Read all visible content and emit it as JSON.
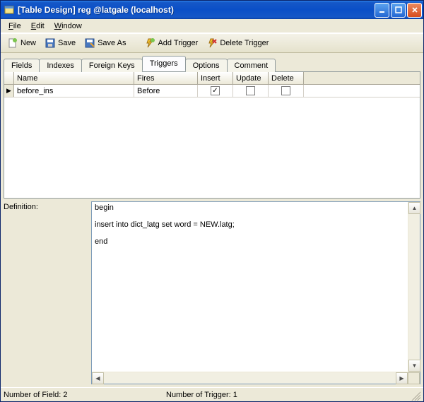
{
  "window": {
    "title": "[Table Design] reg @latgale (localhost)"
  },
  "menu": {
    "file": "File",
    "edit": "Edit",
    "window": "Window"
  },
  "toolbar": {
    "new": "New",
    "save": "Save",
    "save_as": "Save As",
    "add_trigger": "Add Trigger",
    "delete_trigger": "Delete Trigger"
  },
  "tabs": {
    "fields": "Fields",
    "indexes": "Indexes",
    "foreign_keys": "Foreign Keys",
    "triggers": "Triggers",
    "options": "Options",
    "comment": "Comment",
    "active": "triggers"
  },
  "grid": {
    "headers": {
      "name": "Name",
      "fires": "Fires",
      "insert": "Insert",
      "update": "Update",
      "delete": "Delete"
    },
    "rows": [
      {
        "name": "before_ins",
        "fires": "Before",
        "insert": true,
        "update": false,
        "delete": false,
        "current": true
      }
    ]
  },
  "definition": {
    "label": "Definition:",
    "text": "begin\n\ninsert into dict_latg set word = NEW.latg;\n\nend"
  },
  "status": {
    "fields": "Number of Field: 2",
    "triggers": "Number of Trigger: 1"
  }
}
